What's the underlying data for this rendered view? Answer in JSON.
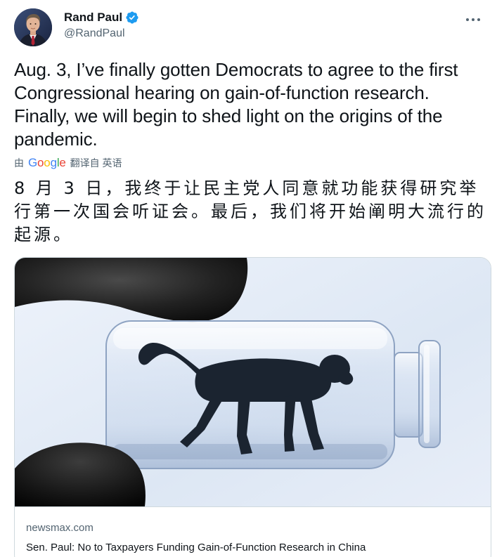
{
  "author": {
    "display_name": "Rand Paul",
    "handle": "@RandPaul",
    "verified": true,
    "verified_color": "#1d9bf0"
  },
  "tweet": {
    "text_en": "Aug. 3, I’ve finally gotten Democrats to agree to the first Congressional hearing on gain-of-function research. Finally, we will begin to shed light on the origins of the pandemic.",
    "translation": {
      "prefix": "由",
      "provider": "Google",
      "label": "翻译自 英语",
      "text_zh": "8 月 3 日，我终于让民主党人同意就功能获得研究举行第一次国会听证会。最后，我们将开始阐明大流行的起源。"
    }
  },
  "card": {
    "domain": "newsmax.com",
    "title": "Sen. Paul: No to Taxpayers Funding Gain-of-Function Research in China",
    "image_icon": "monkey-in-vial-image"
  },
  "icons": {
    "more": "more-horizontal-icon",
    "verified": "verified-badge-icon"
  },
  "colors": {
    "text": "#0f1419",
    "secondary": "#536471",
    "border": "#cfd9de",
    "google_blue": "#4285f4",
    "google_red": "#ea4335",
    "google_yellow": "#fbbc05",
    "google_green": "#34a853"
  }
}
